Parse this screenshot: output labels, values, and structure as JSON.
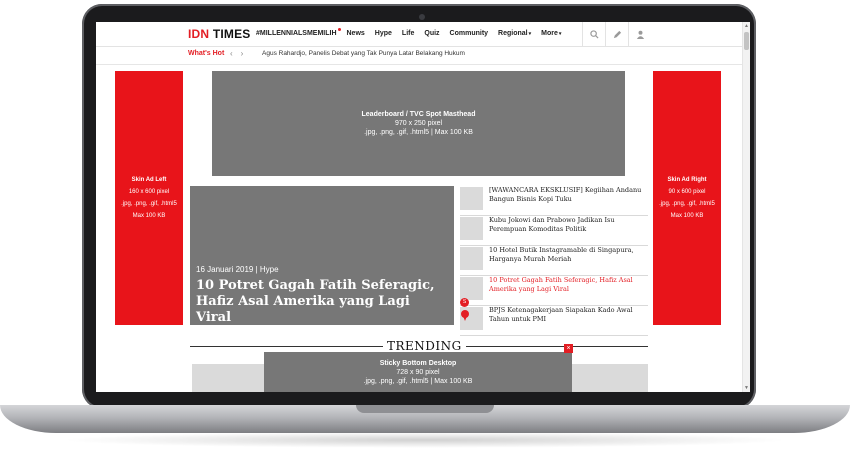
{
  "header": {
    "logo_idn": "IDN",
    "logo_times": "TIMES",
    "nav": [
      {
        "label": "#MILLENNIALSMEMILIH",
        "dot": true
      },
      {
        "label": "News"
      },
      {
        "label": "Hype"
      },
      {
        "label": "Life"
      },
      {
        "label": "Quiz"
      },
      {
        "label": "Community"
      },
      {
        "label": "Regional",
        "caret": "▾"
      },
      {
        "label": "More",
        "caret": "▾"
      }
    ],
    "icons": [
      "search-icon",
      "pencil-icon",
      "user-icon"
    ]
  },
  "whats_hot": {
    "label": "What's Hot",
    "prev": "‹",
    "next": "›",
    "headline": "Agus Rahardjo, Panelis Debat yang Tak Punya Latar Belakang Hukum"
  },
  "ads": {
    "leaderboard": {
      "title": "Leaderboard / TVC Spot Masthead",
      "size": "970 x 250 pixel",
      "formats": ".jpg, .png, .gif, .html5 | Max 100 KB"
    },
    "skin_left": {
      "title": "Skin Ad Left",
      "size": "160 x 600 pixel",
      "formats": ".jpg, .png, .gif, .html5",
      "max": "Max 100 KB"
    },
    "skin_right": {
      "title": "Skin Ad Right",
      "size": "90 x 600 pixel",
      "formats": ".jpg, .png, .gif, .html5",
      "max": "Max 100 KB"
    },
    "sticky": {
      "title": "Sticky Bottom Desktop",
      "size": "728 x 90 pixel",
      "formats": ".jpg, .png, .gif, .html5 | Max 100 KB",
      "close": "×"
    }
  },
  "featured": {
    "meta": "16 Januari 2019 | Hype",
    "title": "10 Potret Gagah Fatih Seferagic, Hafiz Asal Amerika yang Lagi Viral"
  },
  "side_list": [
    {
      "title": "[WAWANCARA EKSKLUSIF] Kegiihan Andanu Bangun Bisnis Kopi Tuku",
      "active": false
    },
    {
      "title": "Kubu Jokowi dan Prabowo Jadikan Isu Perempuan Komoditas Politik",
      "active": false
    },
    {
      "title": "10 Hotel Butik Instagramable di Singapura, Harganya Murah Meriah",
      "active": false
    },
    {
      "title": "10 Potret Gagah Fatih Seferagic, Hafiz Asal Amerika yang Lagi Viral",
      "active": true
    },
    {
      "title": "BPJS Ketenagakerjaan Siapakan Kado Awal Tahun untuk PMI",
      "active": false
    }
  ],
  "trending": {
    "label": "TRENDING"
  },
  "colors": {
    "brand_red": "#e31e24",
    "ad_gray": "#777777",
    "ad_red": "#e8141a"
  }
}
